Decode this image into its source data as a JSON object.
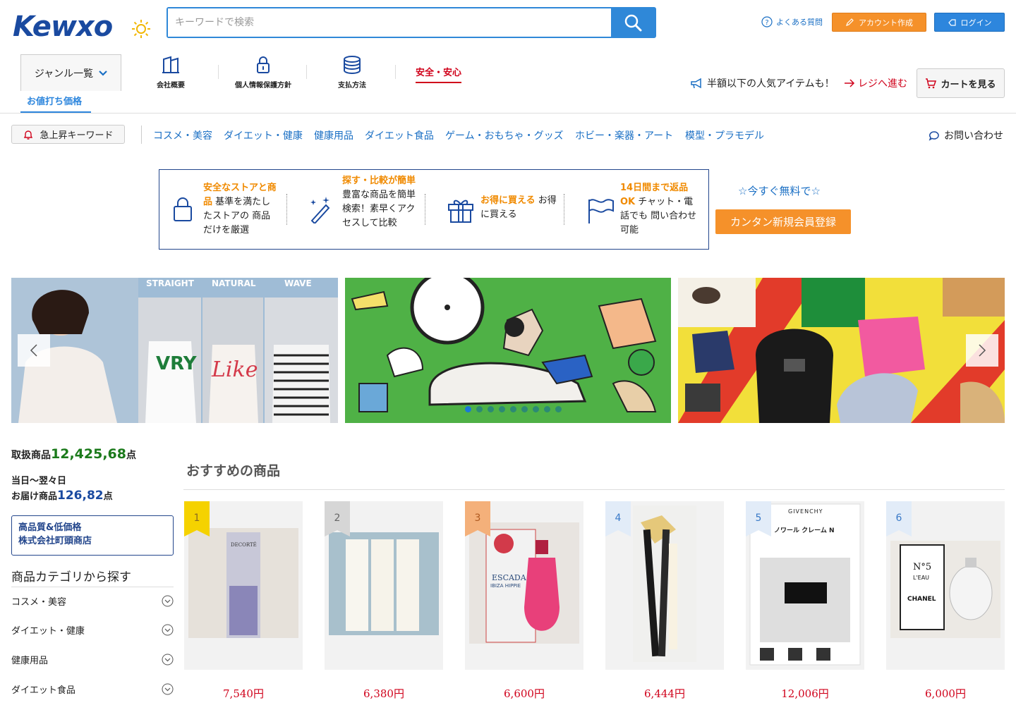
{
  "header": {
    "logo": "Kewxo",
    "search_placeholder": "キーワードで検索",
    "faq": "よくある質問",
    "account_create": "アカウント作成",
    "login": "ログイン"
  },
  "nav": {
    "genre": "ジャンル一覧",
    "company": "会社概要",
    "privacy": "個人情報保護方針",
    "payment": "支払方法",
    "safety": "安全・安心",
    "promo": "半額以下の人気アイテムも！",
    "register": "レジへ進む",
    "cart": "カートを見る",
    "discount_tab": "お値打ち価格"
  },
  "keywords": {
    "hot": "急上昇キーワード",
    "items": [
      "コスメ・美容",
      "ダイエット・健康",
      "健康用品",
      "ダイエット食品",
      "ゲーム・おもちゃ・グッズ",
      "ホビー・楽器・アート",
      "模型・プラモデル"
    ],
    "contact": "お問い合わせ"
  },
  "features": [
    {
      "hl": "安全なストアと商品",
      "text": " 基準を満たしたストアの 商品だけを厳選"
    },
    {
      "hl": "探す・比較が簡単",
      "text": " 豊富な商品を簡単検索！素早くアクセスして比較"
    },
    {
      "hl": "お得に買える",
      "text": " お得に買える"
    },
    {
      "hl": "14日間まで返品OK",
      "text": " チャット・電話でも 問い合わせ可能"
    }
  ],
  "signup": {
    "free_now": "☆今すぐ無料で☆",
    "button": "カンタン新規会員登録"
  },
  "banner": {
    "labels": [
      "STRAIGHT",
      "NATURAL",
      "WAVE"
    ],
    "dots_total": 9,
    "dots_active": 0
  },
  "sidebar": {
    "stat1_label": "取扱商品",
    "stat1_num": "12,425,68",
    "stat1_unit": "点",
    "stat2_line1": "当日〜翌々日",
    "stat2_label": "お届け商品",
    "stat2_num": "126,82",
    "stat2_unit": "点",
    "shop_line1": "高品質&低価格",
    "shop_line2": "株式会社町頭商店",
    "cat_title": "商品カテゴリから探す",
    "categories": [
      "コスメ・美容",
      "ダイエット・健康",
      "健康用品",
      "ダイエット食品"
    ]
  },
  "recommend": {
    "title": "おすすめの商品",
    "products": [
      {
        "rank": "1",
        "price": "7,540円",
        "rank_color": "#f5d200"
      },
      {
        "rank": "2",
        "price": "6,380円",
        "rank_color": "#d6d6d6"
      },
      {
        "rank": "3",
        "price": "6,600円",
        "rank_color": "#f4b07a"
      },
      {
        "rank": "4",
        "price": "6,444円",
        "rank_color": "#e2ecf8"
      },
      {
        "rank": "5",
        "price": "12,006円",
        "rank_color": "#e2ecf8"
      },
      {
        "rank": "6",
        "price": "6,000円",
        "rank_color": "#e2ecf8"
      }
    ],
    "product_texts": [
      "DECORTÉ",
      "ESCADA",
      "IBIZA HIPPIE",
      "GIVENCHY",
      "ノワール クレーム N",
      "N°5",
      "L'EAU",
      "CHANEL"
    ]
  }
}
